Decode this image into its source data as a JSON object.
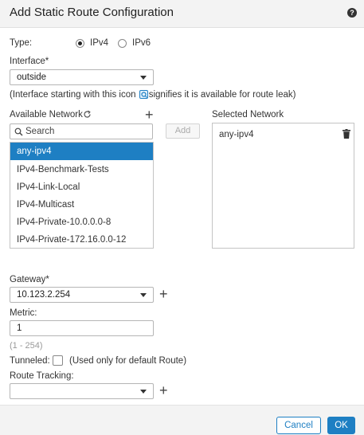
{
  "dialog": {
    "title": "Add Static Route Configuration",
    "help_icon": "question-circle-icon"
  },
  "type": {
    "label": "Type:",
    "options": [
      {
        "label": "IPv4",
        "checked": true
      },
      {
        "label": "IPv6",
        "checked": false
      }
    ]
  },
  "interface": {
    "label": "Interface*",
    "value": "outside",
    "note_before": "(Interface starting with this icon",
    "note_after": "signifies it is available for route leak)",
    "note_icon": "route-leak-icon"
  },
  "available_network": {
    "label": "Available Network",
    "refresh_icon": "refresh-icon",
    "add_icon": "plus-icon",
    "search_placeholder": "Search",
    "items": [
      {
        "label": "any-ipv4",
        "selected": true
      },
      {
        "label": "IPv4-Benchmark-Tests",
        "selected": false
      },
      {
        "label": "IPv4-Link-Local",
        "selected": false
      },
      {
        "label": "IPv4-Multicast",
        "selected": false
      },
      {
        "label": "IPv4-Private-10.0.0.0-8",
        "selected": false
      },
      {
        "label": "IPv4-Private-172.16.0.0-12",
        "selected": false
      }
    ]
  },
  "add_button": "Add",
  "selected_network": {
    "label": "Selected Network",
    "items": [
      {
        "label": "any-ipv4",
        "delete_icon": "trash-icon"
      }
    ]
  },
  "gateway": {
    "label": "Gateway*",
    "value": "10.123.2.254"
  },
  "metric": {
    "label": "Metric:",
    "value": "1",
    "range_hint": "(1 - 254)"
  },
  "tunneled": {
    "label": "Tunneled:",
    "note": "(Used only for default Route)",
    "checked": false
  },
  "route_tracking": {
    "label": "Route Tracking:",
    "value": ""
  },
  "footer": {
    "cancel": "Cancel",
    "ok": "OK"
  },
  "colors": {
    "accent": "#1e7fc3",
    "header_bg": "#f3f3f3"
  }
}
